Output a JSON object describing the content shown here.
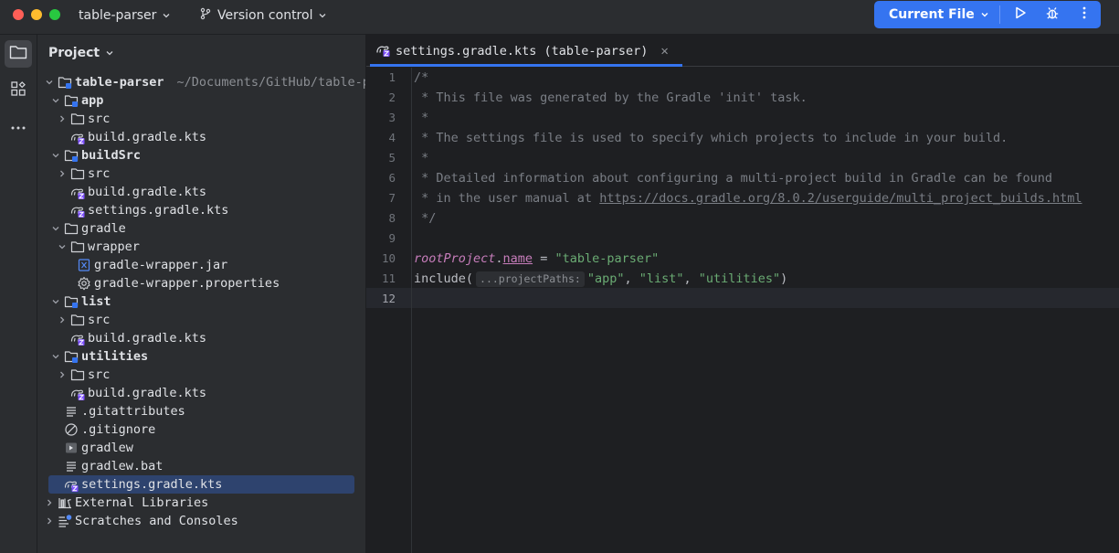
{
  "titlebar": {
    "project_name": "table-parser",
    "vcs_label": "Version control",
    "run_config_label": "Current File",
    "icons": [
      "folder-chevron-icon",
      "branch-icon",
      "play-icon",
      "bug-icon",
      "kebab-icon"
    ]
  },
  "toolstrip": {
    "items": [
      "project-folder-icon",
      "structure-icon",
      "more-icon"
    ]
  },
  "project_panel": {
    "title": "Project",
    "tree": [
      {
        "label": "table-parser",
        "path": "~/Documents/GitHub/table-p",
        "bold": true,
        "indent": 0,
        "arrow": "down",
        "icon": "module-folder"
      },
      {
        "label": "app",
        "bold": true,
        "indent": 1,
        "arrow": "down",
        "icon": "module-folder"
      },
      {
        "label": "src",
        "indent": 2,
        "arrow": "right",
        "icon": "folder"
      },
      {
        "label": "build.gradle.kts",
        "indent": 2,
        "arrow": "none",
        "icon": "gradle-kts"
      },
      {
        "label": "buildSrc",
        "bold": true,
        "indent": 1,
        "arrow": "down",
        "icon": "module-folder"
      },
      {
        "label": "src",
        "indent": 2,
        "arrow": "right",
        "icon": "folder"
      },
      {
        "label": "build.gradle.kts",
        "indent": 2,
        "arrow": "none",
        "icon": "gradle-kts"
      },
      {
        "label": "settings.gradle.kts",
        "indent": 2,
        "arrow": "none",
        "icon": "gradle-kts"
      },
      {
        "label": "gradle",
        "indent": 1,
        "arrow": "down",
        "icon": "folder"
      },
      {
        "label": "wrapper",
        "indent": 2,
        "arrow": "down",
        "icon": "folder"
      },
      {
        "label": "gradle-wrapper.jar",
        "indent": 3,
        "arrow": "none",
        "icon": "jar"
      },
      {
        "label": "gradle-wrapper.properties",
        "indent": 3,
        "arrow": "none",
        "icon": "gear"
      },
      {
        "label": "list",
        "bold": true,
        "indent": 1,
        "arrow": "down",
        "icon": "module-folder"
      },
      {
        "label": "src",
        "indent": 2,
        "arrow": "right",
        "icon": "folder"
      },
      {
        "label": "build.gradle.kts",
        "indent": 2,
        "arrow": "none",
        "icon": "gradle-kts"
      },
      {
        "label": "utilities",
        "bold": true,
        "indent": 1,
        "arrow": "down",
        "icon": "module-folder"
      },
      {
        "label": "src",
        "indent": 2,
        "arrow": "right",
        "icon": "folder"
      },
      {
        "label": "build.gradle.kts",
        "indent": 2,
        "arrow": "none",
        "icon": "gradle-kts"
      },
      {
        "label": ".gitattributes",
        "indent": 1,
        "arrow": "none",
        "icon": "text"
      },
      {
        "label": ".gitignore",
        "indent": 1,
        "arrow": "none",
        "icon": "ignore"
      },
      {
        "label": "gradlew",
        "indent": 1,
        "arrow": "none",
        "icon": "script"
      },
      {
        "label": "gradlew.bat",
        "indent": 1,
        "arrow": "none",
        "icon": "text"
      },
      {
        "label": "settings.gradle.kts",
        "indent": 1,
        "arrow": "none",
        "icon": "gradle-kts",
        "selected": true
      },
      {
        "label": "External Libraries",
        "indent": 0,
        "arrow": "right",
        "icon": "library"
      },
      {
        "label": "Scratches and Consoles",
        "indent": 0,
        "arrow": "right",
        "icon": "scratches"
      }
    ]
  },
  "editor": {
    "tab_label": "settings.gradle.kts (table-parser)",
    "current_line": 12,
    "lines": [
      {
        "n": "1",
        "t": "/*"
      },
      {
        "n": "2",
        "t": " * This file was generated by the Gradle 'init' task."
      },
      {
        "n": "3",
        "t": " *"
      },
      {
        "n": "4",
        "t": " * The settings file is used to specify which projects to include in your build."
      },
      {
        "n": "5",
        "t": " *"
      },
      {
        "n": "6",
        "t": " * Detailed information about configuring a multi-project build in Gradle can be found"
      },
      {
        "n": "7",
        "t": " * in the user manual at ",
        "link": "https://docs.gradle.org/8.0.2/userguide/multi_project_builds.html"
      },
      {
        "n": "8",
        "t": " */"
      },
      {
        "n": "9",
        "t": ""
      },
      {
        "n": "10",
        "receiver": "rootProject",
        "dot": ".",
        "prop": "name",
        "op": " = ",
        "str": "\"table-parser\""
      },
      {
        "n": "11",
        "fn": "include(",
        "hint": "...projectPaths:",
        "args": [
          "\"app\"",
          "\"list\"",
          "\"utilities\""
        ],
        "close": ")"
      },
      {
        "n": "12",
        "t": ""
      }
    ]
  }
}
